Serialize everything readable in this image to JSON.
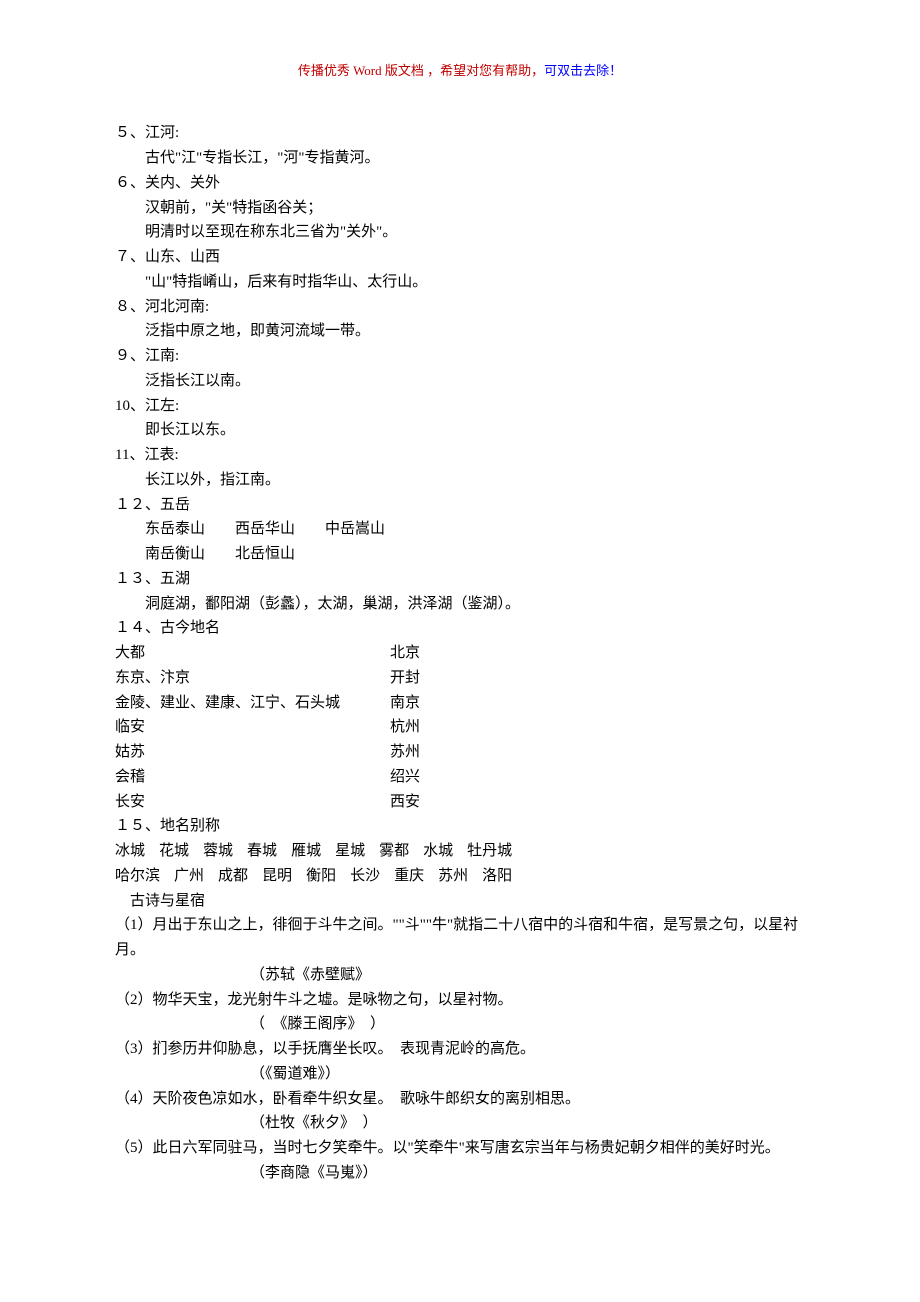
{
  "header": {
    "part1": "传播优秀 Word 版文档 ，希望对您有帮助，",
    "part2": "可双击去除！"
  },
  "items": [
    {
      "num": "５、",
      "title": "江河:",
      "lines": [
        "古代\"江\"专指长江，\"河\"专指黄河。"
      ]
    },
    {
      "num": "６、",
      "title": "关内、关外",
      "lines": [
        "汉朝前，\"关\"特指函谷关；",
        "明清时以至现在称东北三省为\"关外\"。"
      ]
    },
    {
      "num": "７、",
      "title": "山东、山西",
      "lines": [
        "\"山\"特指崤山，后来有时指华山、太行山。"
      ]
    },
    {
      "num": "８、",
      "title": "河北河南:",
      "lines": [
        "泛指中原之地，即黄河流域一带。"
      ]
    },
    {
      "num": "９、",
      "title": "江南:",
      "lines": [
        "泛指长江以南。"
      ]
    },
    {
      "num": "10、",
      "title": "江左:",
      "lines": [
        "即长江以东。"
      ]
    },
    {
      "num": "11、",
      "title": "江表:",
      "lines": [
        "长江以外，指江南。"
      ]
    },
    {
      "num": "１２、",
      "title": "五岳",
      "lines": [
        "东岳泰山　　西岳华山　　中岳嵩山",
        "南岳衡山　　北岳恒山"
      ]
    },
    {
      "num": "１３、",
      "title": "五湖",
      "lines": [
        "洞庭湖，鄱阳湖（彭蠡），太湖，巢湖，洪泽湖（鉴湖）。"
      ]
    },
    {
      "num": "１４、",
      "title": "古今地名"
    },
    {
      "num": "１５、",
      "title": "地名别称"
    }
  ],
  "places": [
    {
      "old": "大都",
      "new": "北京"
    },
    {
      "old": "东京、汴京",
      "new": "开封"
    },
    {
      "old": "金陵、建业、建康、江宁、石头城",
      "new": "南京"
    },
    {
      "old": "临安",
      "new": "杭州"
    },
    {
      "old": "姑苏",
      "new": "苏州"
    },
    {
      "old": "会稽",
      "new": "绍兴"
    },
    {
      "old": "长安",
      "new": "西安"
    }
  ],
  "alias_row1": [
    "冰城",
    "花城",
    "蓉城",
    "春城",
    "雁城",
    "星城",
    "雾都",
    "水城",
    "牡丹城"
  ],
  "alias_row2": [
    "哈尔滨",
    "广州",
    "成都",
    "昆明",
    "衡阳",
    "长沙",
    "重庆",
    "苏州",
    "洛阳"
  ],
  "poem": {
    "heading": "古诗与星宿",
    "entries": [
      {
        "body": "（1）月出于东山之上，徘徊于斗牛之间。\"\"斗\"\"牛\"就指二十八宿中的斗宿和牛宿，是写景之句，以星衬月。",
        "src": "（苏轼《赤壁赋》"
      },
      {
        "body": "（2）物华天宝，龙光射牛斗之墟。是咏物之句，以星衬物。",
        "src": "（　《滕王阁序》　）"
      },
      {
        "body": "（3）扪参历井仰胁息，以手抚膺坐长叹。　表现青泥岭的高危。",
        "src": "（《蜀道难》）"
      },
      {
        "body": "（4）天阶夜色凉如水，卧看牵牛织女星。　歌咏牛郎织女的离别相思。",
        "src": "（杜牧《秋夕》　）"
      },
      {
        "body": "（5）此日六军同驻马，当时七夕笑牵牛。以\"笑牵牛\"来写唐玄宗当年与杨贵妃朝夕相伴的美好时光。",
        "src": "（李商隐《马嵬》）"
      }
    ]
  }
}
